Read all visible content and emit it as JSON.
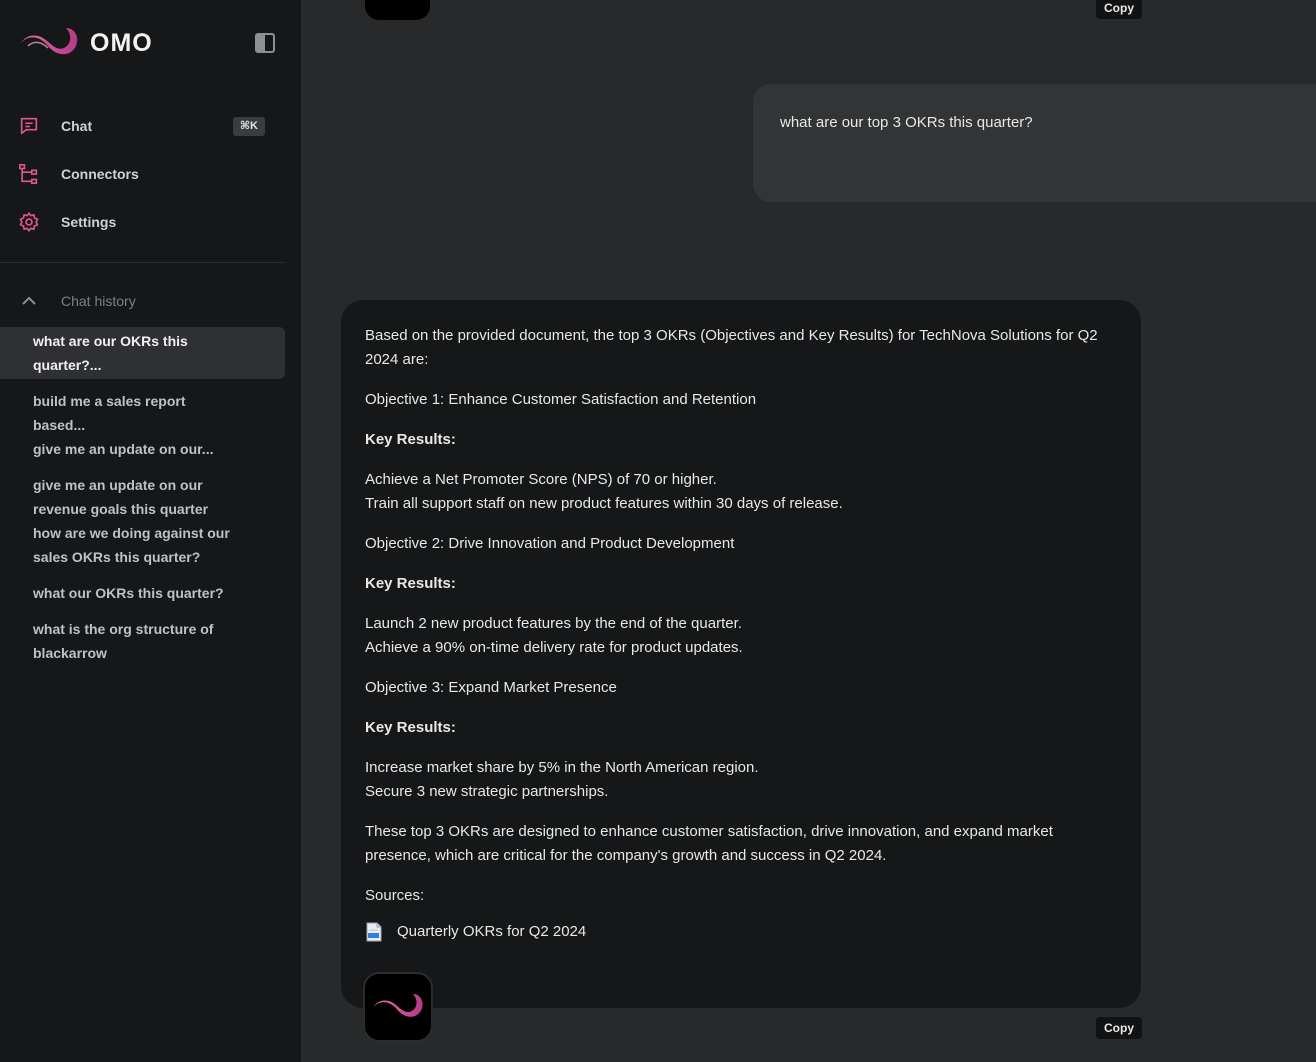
{
  "brand": {
    "name": "OMO"
  },
  "nav": {
    "chat": {
      "label": "Chat",
      "shortcut": "⌘K"
    },
    "connectors": {
      "label": "Connectors"
    },
    "settings": {
      "label": "Settings"
    }
  },
  "history": {
    "title": "Chat history",
    "items": [
      "what are our OKRs this quarter?...",
      "build me a sales report based...",
      "give me an update on our...",
      "give me an update on our revenue goals this quarter",
      "how are we doing against our sales OKRs this quarter?",
      "what our OKRs this quarter?",
      "what is the org structure of blackarrow"
    ]
  },
  "conversation": {
    "copy_label": "Copy",
    "user_message": "what are our top 3 OKRs this quarter?",
    "assistant": {
      "intro": "Based on the provided document, the top 3 OKRs (Objectives and Key Results) for TechNova Solutions for Q2 2024 are:",
      "objective1": "Objective 1: Enhance Customer Satisfaction and Retention",
      "kr_heading": "Key Results:",
      "o1_kr1": "Achieve a Net Promoter Score (NPS) of 70 or higher.",
      "o1_kr2": "Train all support staff on new product features within 30 days of release.",
      "objective2": "Objective 2: Drive Innovation and Product Development",
      "o2_kr1": "Launch 2 new product features by the end of the quarter.",
      "o2_kr2": "Achieve a 90% on-time delivery rate for product updates.",
      "objective3": "Objective 3: Expand Market Presence",
      "o3_kr1": "Increase market share by 5% in the North American region.",
      "o3_kr2": "Secure 3 new strategic partnerships.",
      "conclusion": "These top 3 OKRs are designed to enhance customer satisfaction, drive innovation, and expand market presence, which are critical for the company's growth and success in Q2 2024.",
      "sources_label": "Sources:",
      "source_doc": "Quarterly OKRs for Q2 2024"
    }
  },
  "colors": {
    "accent_pink": "#e2568f",
    "sidebar_bg": "#151718",
    "main_bg": "#27292a"
  }
}
